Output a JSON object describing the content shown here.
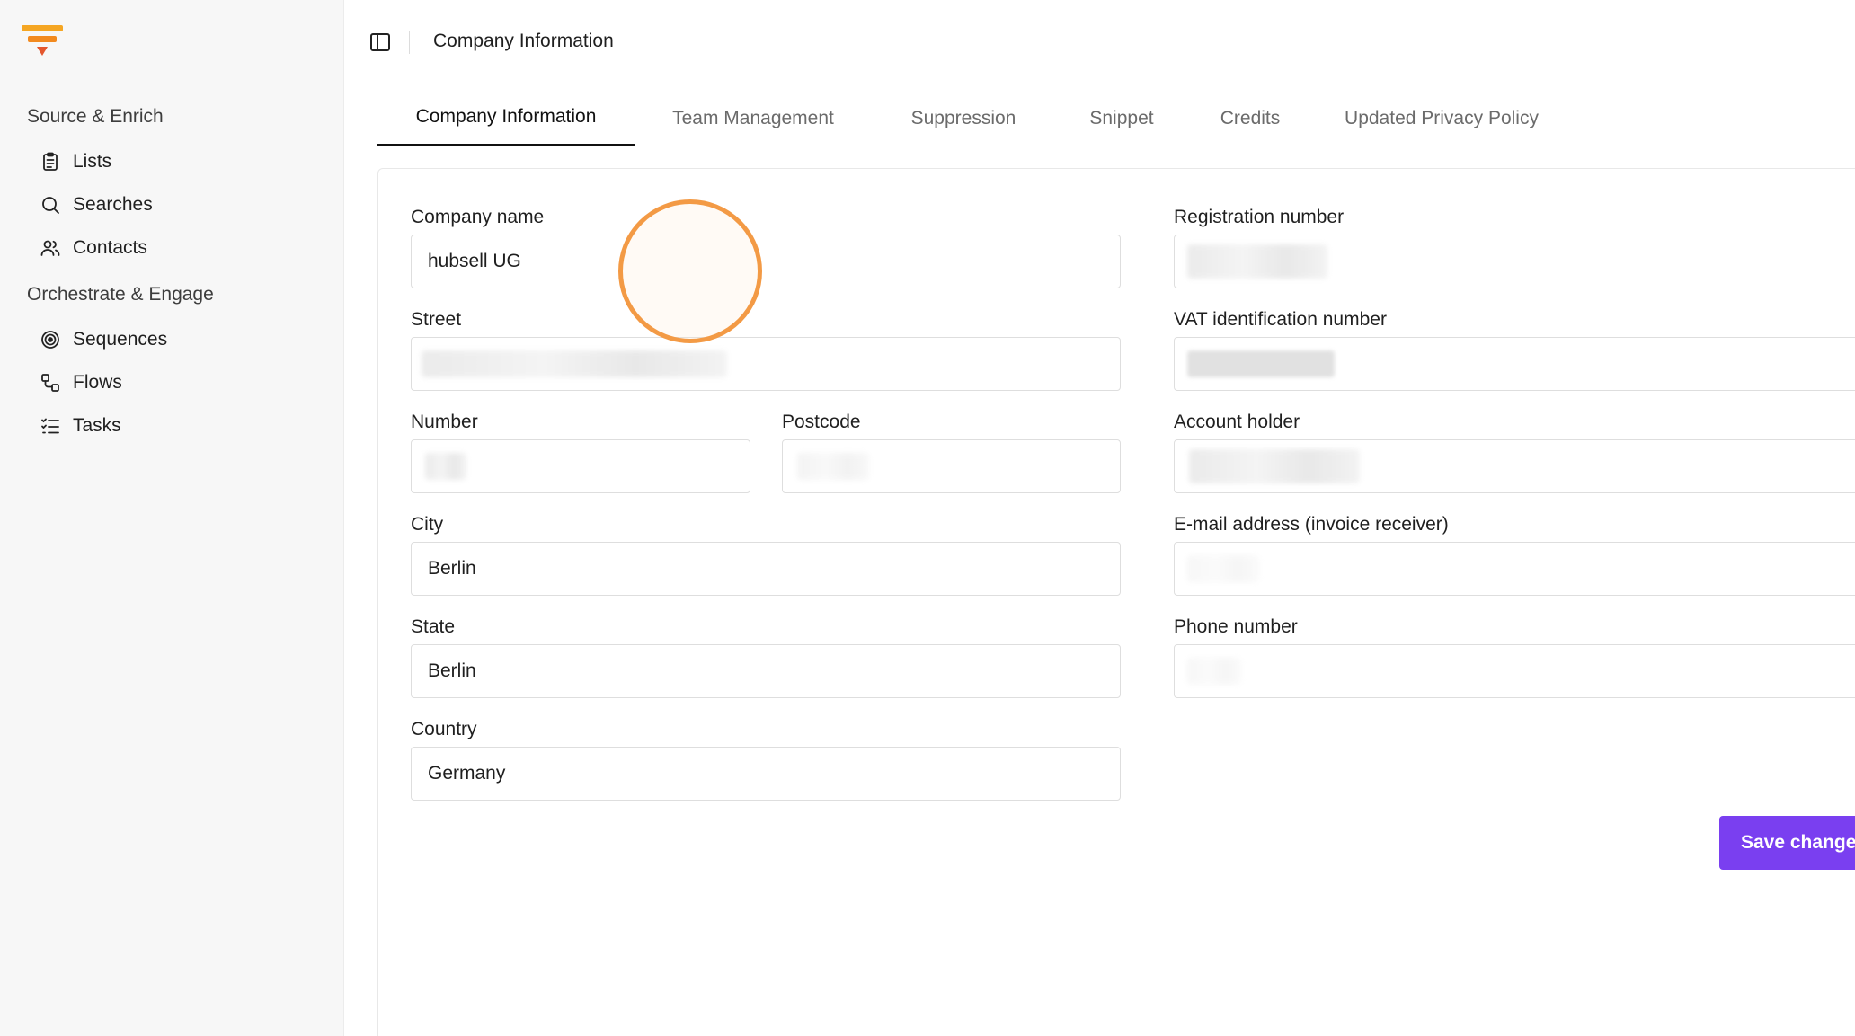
{
  "sidebar": {
    "sections": [
      {
        "title": "Source & Enrich",
        "items": [
          {
            "label": "Lists",
            "icon": "clipboard-list-icon"
          },
          {
            "label": "Searches",
            "icon": "search-icon"
          },
          {
            "label": "Contacts",
            "icon": "users-icon"
          }
        ]
      },
      {
        "title": "Orchestrate & Engage",
        "items": [
          {
            "label": "Sequences",
            "icon": "target-icon"
          },
          {
            "label": "Flows",
            "icon": "flow-icon"
          },
          {
            "label": "Tasks",
            "icon": "task-list-icon"
          }
        ]
      }
    ]
  },
  "header": {
    "title": "Company Information"
  },
  "tabs": [
    {
      "label": "Company Information",
      "active": true
    },
    {
      "label": "Team Management"
    },
    {
      "label": "Suppression"
    },
    {
      "label": "Snippet"
    },
    {
      "label": "Credits"
    },
    {
      "label": "Updated Privacy Policy"
    }
  ],
  "form": {
    "company_name": {
      "label": "Company name",
      "value": "hubsell UG"
    },
    "street": {
      "label": "Street",
      "value": ""
    },
    "number": {
      "label": "Number",
      "value": ""
    },
    "postcode": {
      "label": "Postcode",
      "value": ""
    },
    "city": {
      "label": "City",
      "value": "Berlin"
    },
    "state": {
      "label": "State",
      "value": "Berlin"
    },
    "country": {
      "label": "Country",
      "value": "Germany"
    },
    "registration_number": {
      "label": "Registration number",
      "value": ""
    },
    "vat_number": {
      "label": "VAT identification number",
      "value": ""
    },
    "account_holder": {
      "label": "Account holder",
      "value": ""
    },
    "invoice_email": {
      "label": "E-mail address (invoice receiver)",
      "value": ""
    },
    "phone": {
      "label": "Phone number",
      "value": ""
    }
  },
  "actions": {
    "save_label": "Save changes"
  },
  "colors": {
    "accent": "#7a3ff0",
    "logo_orange": "#f5a623",
    "click_ring": "#f39a45"
  }
}
